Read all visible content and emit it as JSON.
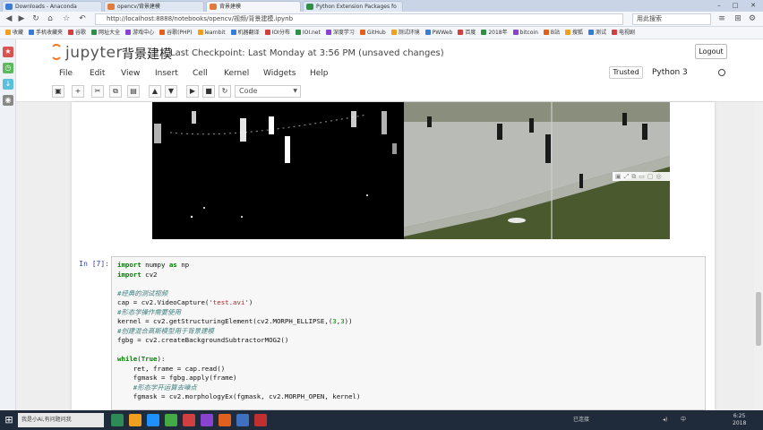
{
  "browser": {
    "tabs": [
      {
        "label": "Downloads - Anaconda",
        "color": "#3a7bd5"
      },
      {
        "label": "opencv/背景建模",
        "color": "#e07b39"
      },
      {
        "label": "背景建模",
        "color": "#e07b39"
      },
      {
        "label": "Python Extension Packages fo",
        "color": "#2f8f46"
      }
    ],
    "window_controls": [
      "–",
      "□",
      "✕"
    ],
    "url": "http://localhost:8888/notebooks/opencv/视频/背景建模.ipynb",
    "search_text": "用此搜索",
    "bookmarks": [
      "收藏",
      "手机收藏夹",
      "谷歌",
      "网址大全",
      "游戏中心",
      "谷歌(PHP)",
      "learnbit",
      "机器翻译",
      "IOI分布",
      "IOI.net",
      "深度学习",
      "GitHub",
      "测试环境",
      "PWWeb",
      "百度",
      "2018年",
      "bitcoin",
      "B站",
      "搜狐",
      "测试",
      "电视剧"
    ]
  },
  "sidebar": {
    "icons": [
      "favorites-icon",
      "history-icon",
      "download-icon",
      "extension-icon"
    ]
  },
  "jupyter": {
    "logo": "jupyter",
    "notebook_name": "背景建模",
    "checkpoint": "Last Checkpoint: Last Monday at 3:56 PM (unsaved changes)",
    "logout": "Logout",
    "menu": [
      "File",
      "Edit",
      "View",
      "Insert",
      "Cell",
      "Kernel",
      "Widgets",
      "Help"
    ],
    "trusted": "Trusted",
    "kernel": "Python 3",
    "cell_type": "Code"
  },
  "cell": {
    "prompt": "In [7]:",
    "code_lines": [
      [
        {
          "t": "import",
          "c": "kw"
        },
        {
          "t": " numpy "
        },
        {
          "t": "as",
          "c": "kw"
        },
        {
          "t": " np"
        }
      ],
      [
        {
          "t": "import",
          "c": "kw"
        },
        {
          "t": " cv2"
        }
      ],
      [
        {
          "t": ""
        }
      ],
      [
        {
          "t": "#经典的测试视频",
          "c": "cm"
        }
      ],
      [
        {
          "t": "cap = cv2.VideoCapture("
        },
        {
          "t": "'test.avi'",
          "c": "str"
        },
        {
          "t": ")"
        }
      ],
      [
        {
          "t": "#形态学操作需要使用",
          "c": "cm"
        }
      ],
      [
        {
          "t": "kernel = cv2.getStructuringElement(cv2.MORPH_ELLIPSE,("
        },
        {
          "t": "3",
          "c": "num"
        },
        {
          "t": ","
        },
        {
          "t": "3",
          "c": "num"
        },
        {
          "t": "))"
        }
      ],
      [
        {
          "t": "#创建混合高斯模型用于背景建模",
          "c": "cm"
        }
      ],
      [
        {
          "t": "fgbg = cv2.createBackgroundSubtractorMOG2()"
        }
      ],
      [
        {
          "t": ""
        }
      ],
      [
        {
          "t": "while",
          "c": "kw"
        },
        {
          "t": "("
        },
        {
          "t": "True",
          "c": "kw"
        },
        {
          "t": "):"
        }
      ],
      [
        {
          "t": "    ret, frame = cap.read()"
        }
      ],
      [
        {
          "t": "    fgmask = fgbg.apply(frame)"
        }
      ],
      [
        {
          "t": "    #形态学开运算去噪点",
          "c": "cm"
        }
      ],
      [
        {
          "t": "    fgmask = cv2.morphologyEx(fgmask, cv2.MORPH_OPEN, kernel)"
        }
      ]
    ]
  },
  "taskbar": {
    "search_placeholder": "我是小Ai,有问题问我",
    "items_colors": [
      "#2e8b57",
      "#f0a020",
      "#1e90ff",
      "#44aa44",
      "#d04040",
      "#8844cc",
      "#e06020",
      "#4070c0",
      "#c03030"
    ],
    "tray_text": "已连接",
    "clock_time": "6:25",
    "clock_date": "2018"
  }
}
